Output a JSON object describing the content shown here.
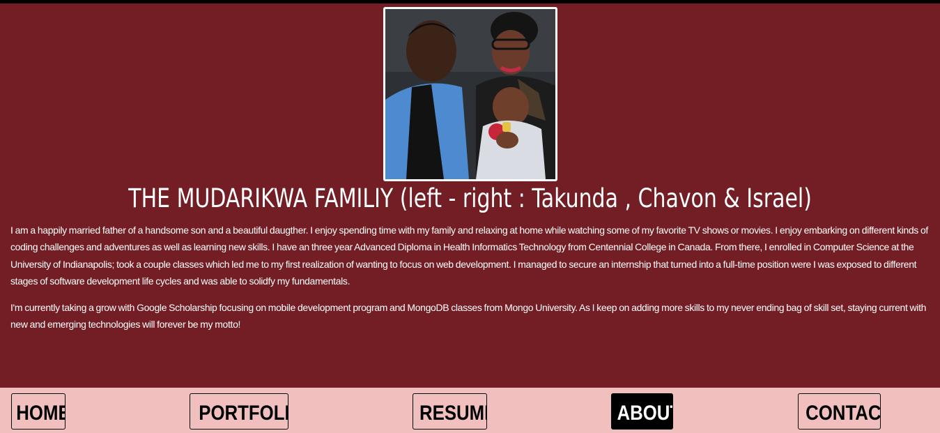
{
  "colors": {
    "background": "#731d24",
    "nav_background": "#f2bfbf",
    "text": "#ffffff",
    "active_nav_bg": "#000000"
  },
  "photo": {
    "alt": "family-photo"
  },
  "caption": "THE MUDARIKWA FAMILIY (left - right : Takunda , Chavon & Israel)",
  "bio": {
    "paragraph_1": "I am a happily married father of a handsome son and a beautiful daugther. I enjoy spending time with my family and relaxing at home while watching some of my favorite TV shows or movies. I enjoy embarking on different kinds of coding challenges and adventures as well as learning new skills. I have an three year Advanced Diploma in Health Informatics Technology from Centennial College in Canada. From there, I enrolled in Computer Science at the University of Indianapolis; took a couple classes which led me to my first realization of wanting to focus on web development. I managed to secure an internship that turned into a full-time position were I was exposed to different stages of software development life cycles and was able to solidfy my fundamentals.",
    "paragraph_2": "I'm currently taking a grow with Google Scholarship focusing on mobile development program and MongoDB classes from Mongo University. As I keep on adding more skills to my never ending bag of skill set, staying current with new and emerging technologies will forever be my motto!"
  },
  "nav": {
    "home": "HOME",
    "portfolio": "PORTFOLIO",
    "resume": "RESUME",
    "about": "ABOUT",
    "contact": "CONTACT",
    "active": "about"
  }
}
